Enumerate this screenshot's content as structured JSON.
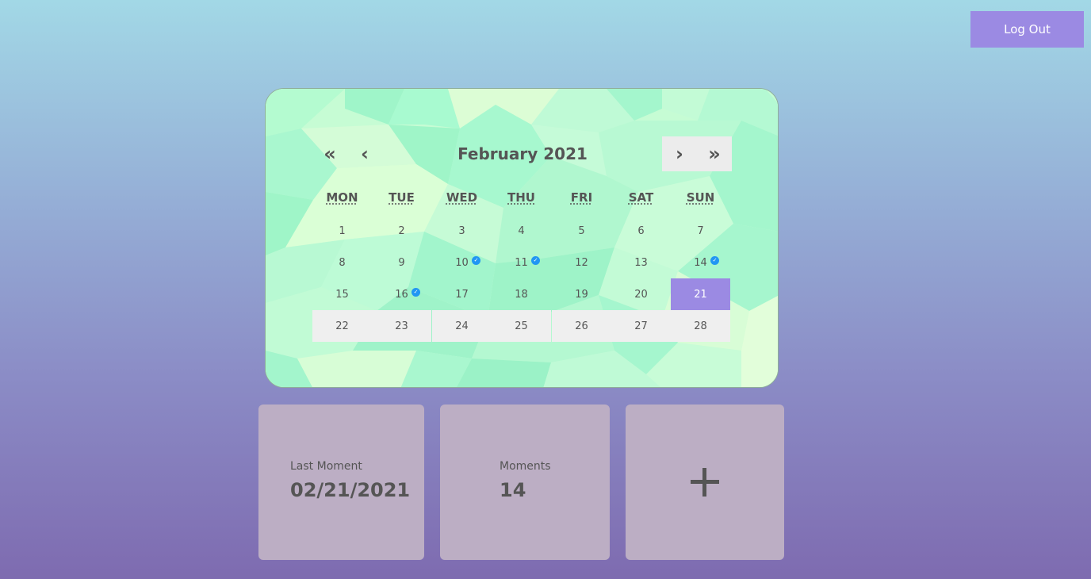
{
  "header": {
    "logout_label": "Log Out"
  },
  "calendar": {
    "title": "February 2021",
    "nav": {
      "prev_year": "«",
      "prev_month": "‹",
      "next_month": "›",
      "next_year": "»"
    },
    "weekdays": [
      "MON",
      "TUE",
      "WED",
      "THU",
      "FRI",
      "SAT",
      "SUN"
    ],
    "weeks": [
      [
        "1",
        "2",
        "3",
        "4",
        "5",
        "6",
        "7"
      ],
      [
        "8",
        "9",
        "10",
        "11",
        "12",
        "13",
        "14"
      ],
      [
        "15",
        "16",
        "17",
        "18",
        "19",
        "20",
        "21"
      ],
      [
        "22",
        "23",
        "24",
        "25",
        "26",
        "27",
        "28"
      ]
    ],
    "moment_days": [
      "10",
      "11",
      "14",
      "16"
    ],
    "selected_day": "21",
    "colors": {
      "selected": "#9b8ae3",
      "check": "#2196f3",
      "future_bg": "#efefef"
    }
  },
  "cards": {
    "last_moment": {
      "label": "Last Moment",
      "value": "02/21/2021"
    },
    "moments": {
      "label": "Moments",
      "value": "14"
    },
    "add": {
      "icon": "plus-icon"
    }
  }
}
